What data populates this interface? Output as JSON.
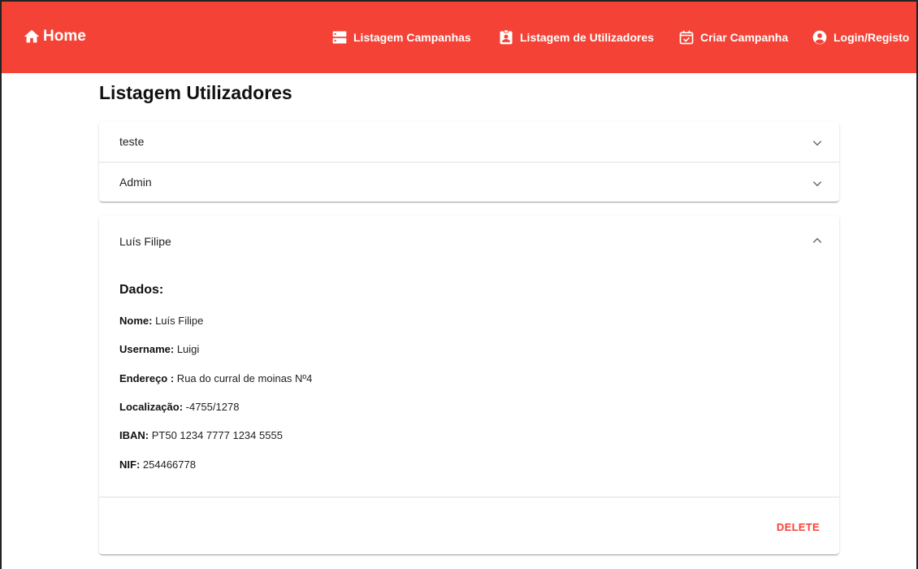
{
  "header": {
    "home_label": "Home",
    "nav": [
      {
        "label": "Listagem Campanhas",
        "icon": "list-icon"
      },
      {
        "label": "Listagem de Utilizadores",
        "icon": "contact-badge-icon"
      },
      {
        "label": "Criar Campanha",
        "icon": "calendar-check-icon"
      },
      {
        "label": "Login/Registo",
        "icon": "account-circle-icon"
      }
    ],
    "color": "#f44336"
  },
  "page": {
    "title": "Listagem Utilizadores"
  },
  "users": [
    {
      "name": "teste",
      "expanded": false
    },
    {
      "name": "Admin",
      "expanded": false
    },
    {
      "name": "Luís Filipe",
      "expanded": true
    }
  ],
  "details": {
    "section_title": "Dados:",
    "fields": [
      {
        "label": "Nome:",
        "value": " Luís Filipe"
      },
      {
        "label": "Username:",
        "value": " Luigi"
      },
      {
        "label": "Endereço :",
        "value": " Rua do curral de moinas Nº4"
      },
      {
        "label": "Localização:",
        "value": " -4755/1278"
      },
      {
        "label": "IBAN:",
        "value": " PT50 1234 7777 1234 5555"
      },
      {
        "label": "NIF:",
        "value": " 254466778"
      }
    ],
    "delete_label": "DELETE"
  }
}
